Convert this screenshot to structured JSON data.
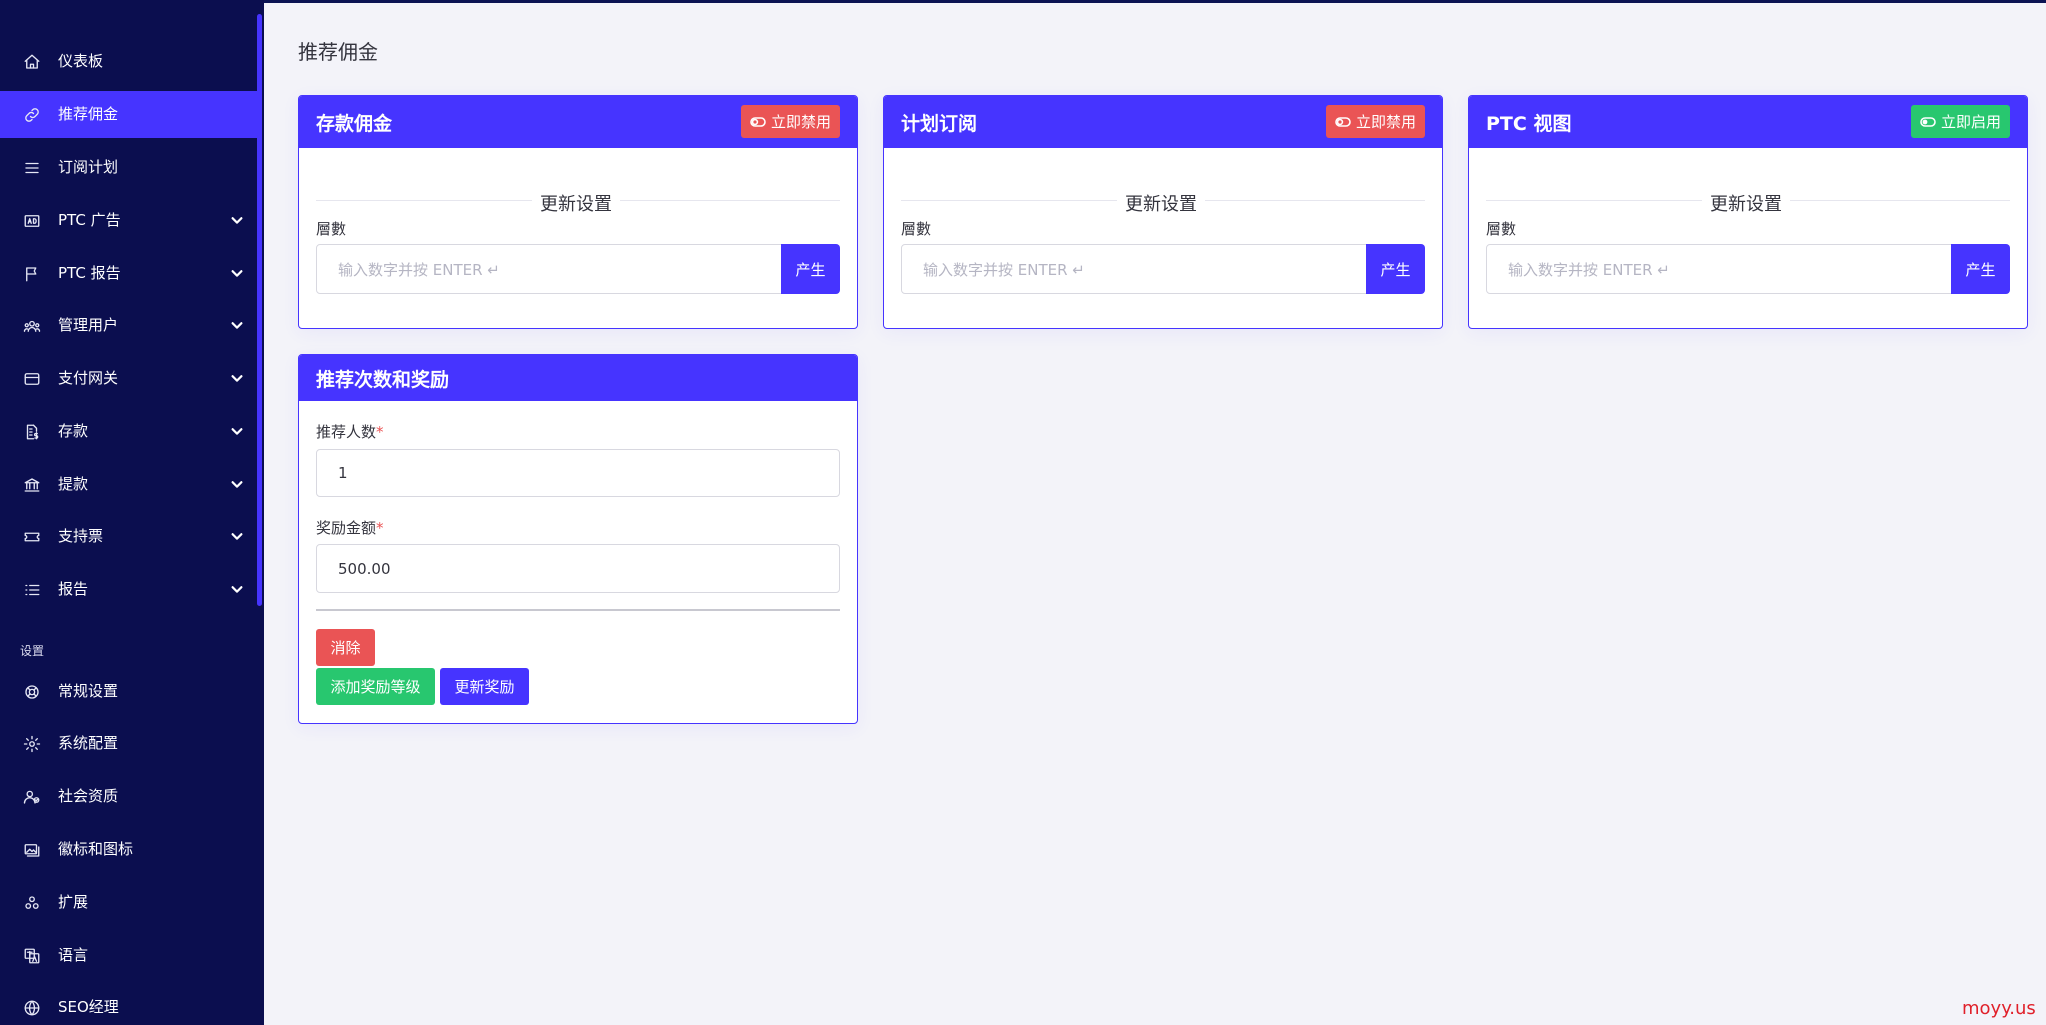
{
  "sidebar": {
    "items": [
      {
        "label": "仪表板",
        "icon": "home-icon",
        "active": false,
        "expandable": false
      },
      {
        "label": "推荐佣金",
        "icon": "link-icon",
        "active": true,
        "expandable": false
      },
      {
        "label": "订阅计划",
        "icon": "menu-icon",
        "active": false,
        "expandable": false
      },
      {
        "label": "PTC 广告",
        "icon": "ad-icon",
        "active": false,
        "expandable": true
      },
      {
        "label": "PTC 报告",
        "icon": "flag-icon",
        "active": false,
        "expandable": true
      },
      {
        "label": "管理用户",
        "icon": "users-icon",
        "active": false,
        "expandable": true
      },
      {
        "label": "支付网关",
        "icon": "credit-card-icon",
        "active": false,
        "expandable": true
      },
      {
        "label": "存款",
        "icon": "invoice-icon",
        "active": false,
        "expandable": true
      },
      {
        "label": "提款",
        "icon": "bank-icon",
        "active": false,
        "expandable": true
      },
      {
        "label": "支持票",
        "icon": "ticket-icon",
        "active": false,
        "expandable": true
      },
      {
        "label": "报告",
        "icon": "list-icon",
        "active": false,
        "expandable": true
      }
    ],
    "section_label": "设置",
    "settings_items": [
      {
        "label": "常规设置",
        "icon": "life-ring-icon"
      },
      {
        "label": "系统配置",
        "icon": "gear-icon"
      },
      {
        "label": "社会资质",
        "icon": "user-check-icon"
      },
      {
        "label": "徽标和图标",
        "icon": "images-icon"
      },
      {
        "label": "扩展",
        "icon": "cogs-icon"
      },
      {
        "label": "语言",
        "icon": "language-icon"
      },
      {
        "label": "SEO经理",
        "icon": "globe-icon"
      }
    ]
  },
  "page": {
    "title": "推荐佣金"
  },
  "cards": [
    {
      "title": "存款佣金",
      "toggle_label": "立即禁用",
      "toggle_color": "#ea5455",
      "divider": "更新设置",
      "field_label": "層數",
      "placeholder": "输入数字并按 ENTER ↵",
      "generate_label": "产生"
    },
    {
      "title": "计划订阅",
      "toggle_label": "立即禁用",
      "toggle_color": "#ea5455",
      "divider": "更新设置",
      "field_label": "層數",
      "placeholder": "输入数字并按 ENTER ↵",
      "generate_label": "产生"
    },
    {
      "title": "PTC 视图",
      "toggle_label": "立即启用",
      "toggle_color": "#28c76f",
      "divider": "更新设置",
      "field_label": "層數",
      "placeholder": "输入数字并按 ENTER ↵",
      "generate_label": "产生"
    }
  ],
  "referral": {
    "title": "推荐次数和奖励",
    "count_label": "推荐人数",
    "count_value": "1",
    "amount_label": "奖励金额",
    "amount_value": "500.00",
    "required_mark": "*",
    "delete_label": "消除",
    "add_label": "添加奖励等级",
    "update_label": "更新奖励"
  },
  "watermark": "moyy.us"
}
